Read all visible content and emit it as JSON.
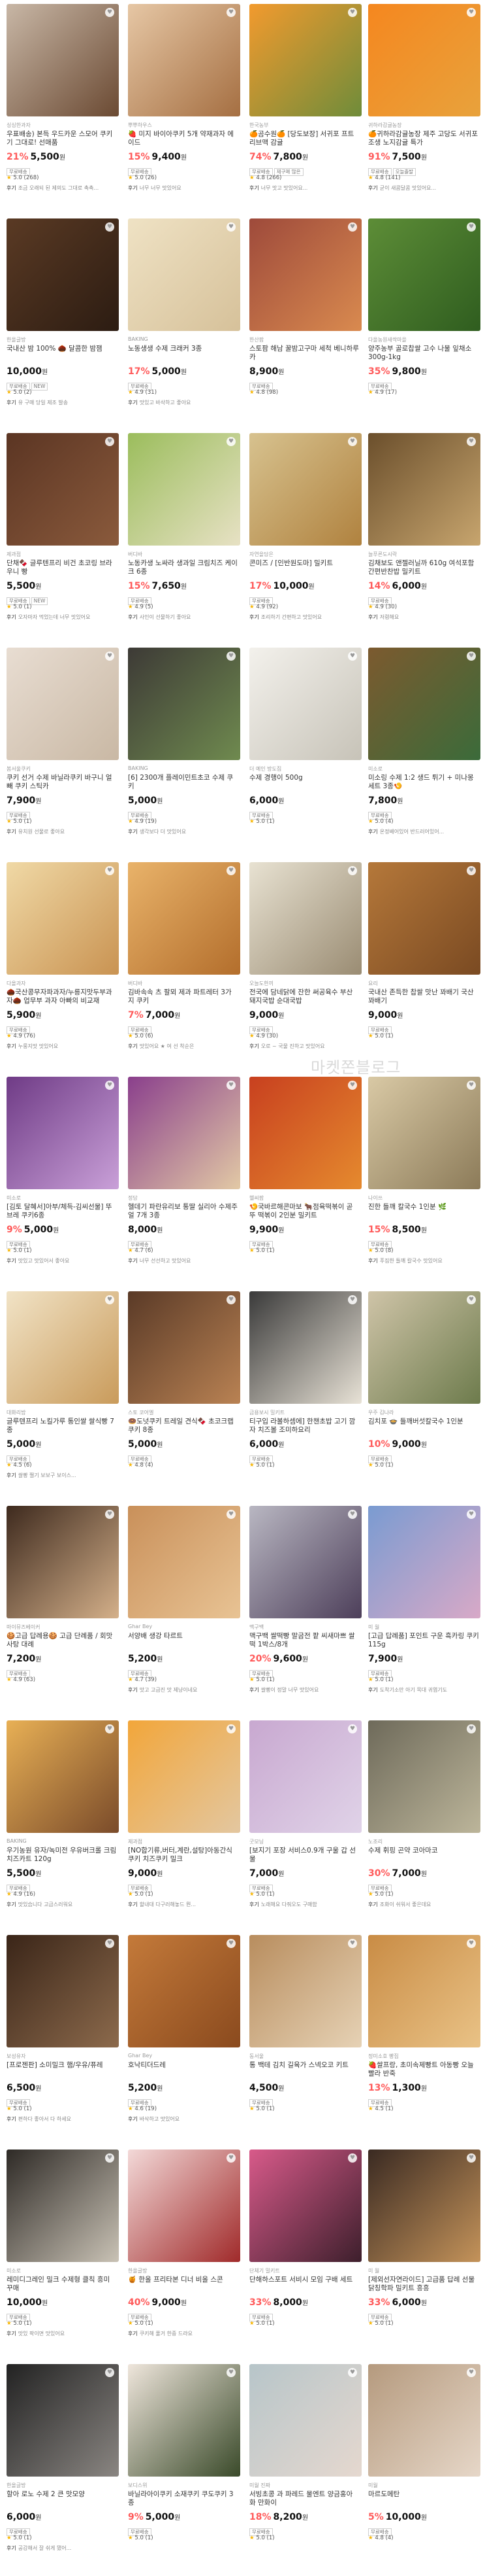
{
  "watermark": "마켓쫀블로그",
  "ui": {
    "tag_free": "무료배송",
    "tag_new": "NEW",
    "tag_min": "제구매 많은",
    "tag_today": "오늘출발",
    "review_label": "후기"
  },
  "products": [
    {
      "seller": "싱싱한과자",
      "name": "우표배송) 본득 우드카운 스모어 쿠키기 그대로! 선매품",
      "discount": "21%",
      "price": "5,500",
      "rating": "5.0",
      "reviews": "(268)",
      "review": "조금 오래되 된 제의도 그대로 촉촉...",
      "tags": [
        "무료배송"
      ],
      "colors": [
        "#c8b7a6",
        "#6b4a33"
      ]
    },
    {
      "seller": "뿌뿌하우스",
      "name": "🍓 미지 바이아쿠키 5개 약재과자 에이드",
      "discount": "15%",
      "price": "9,400",
      "rating": "5.0",
      "reviews": "(26)",
      "review": "너무 너무 맛있어요",
      "tags": [
        "무료배송"
      ],
      "colors": [
        "#e6c7a5",
        "#a56f42"
      ]
    },
    {
      "seller": "한국농부",
      "name": "🍊곰수원🍊 [당도보장] 서귀포 프트 리브맥 감귤",
      "discount": "74%",
      "price": "7,800",
      "rating": "4.8",
      "reviews": "(266)",
      "review": "너무 맛고 맛있어요...",
      "tags": [
        "무료배송",
        "제구매 많은"
      ],
      "colors": [
        "#f29a2e",
        "#6f8c3a"
      ]
    },
    {
      "seller": "귀하라감귤농장",
      "name": "🍊귀하라감귤농장 제주 고당도 서귀포조생 노지감귤 특가",
      "discount": "91%",
      "price": "7,500",
      "rating": "4.8",
      "reviews": "(141)",
      "review": "굳이 새콤달콤 맛있어요...",
      "tags": [
        "무료배송",
        "오늘출발"
      ],
      "colors": [
        "#f5871f",
        "#e8a23c"
      ]
    },
    {
      "seller": "한올글방",
      "name": "국내산 밤 100% 🌰 달콤한 밤잼",
      "discount": "",
      "price": "10,000",
      "rating": "5.0",
      "reviews": "(2)",
      "review": "유 구매 당일 제조 발송",
      "tags": [
        "무료배송",
        "NEW"
      ],
      "colors": [
        "#5a3a24",
        "#2c1c12"
      ]
    },
    {
      "seller": "BAKING",
      "name": "노동생생 수제 크래커 3종",
      "discount": "17%",
      "price": "5,000",
      "rating": "4.9",
      "reviews": "(31)",
      "review": "맛있고 바삭하고 좋아요",
      "tags": [
        "무료배송"
      ],
      "colors": [
        "#efe2c4",
        "#d6c19a"
      ]
    },
    {
      "seller": "한산팜",
      "name": "스토팜 해남 꿀밤고구마 세척 베니하루카",
      "discount": "",
      "price": "8,900",
      "rating": "4.8",
      "reviews": "(98)",
      "review": "",
      "tags": [
        "무료배송"
      ],
      "colors": [
        "#9e4a3b",
        "#d98a4f"
      ]
    },
    {
      "seller": "다올농원새싹마을",
      "name": "양주농부 골로찹쌀 고수 나물 잎채소 300g-1kg",
      "discount": "35%",
      "price": "9,800",
      "rating": "4.9",
      "reviews": "(17)",
      "review": "",
      "tags": [
        "무료배송"
      ],
      "colors": [
        "#5d8d37",
        "#2f5d1f"
      ]
    },
    {
      "seller": "제과점",
      "name": "단채🍫 글루텐프리 비건 초코링 브라우니 빵",
      "discount": "",
      "price": "5,500",
      "rating": "5.0",
      "reviews": "(1)",
      "review": "오자마자 먹었는데 너무 맛있어요",
      "tags": [
        "무료배송",
        "NEW"
      ],
      "colors": [
        "#5b3523",
        "#8a5a3c"
      ]
    },
    {
      "seller": "버디바",
      "name": "노동카생 노싸라 생과일 크림치즈 케이크 6종",
      "discount": "15%",
      "price": "7,650",
      "rating": "4.9",
      "reviews": "(5)",
      "review": "사인이 선물하기 좋아요",
      "tags": [
        "무료배송"
      ],
      "colors": [
        "#9bbd5c",
        "#e7e1c4"
      ]
    },
    {
      "seller": "자연을담은",
      "name": "콘미즈 / [인반원도마] 밀키트",
      "discount": "17%",
      "price": "10,000",
      "rating": "4.9",
      "reviews": "(92)",
      "review": "조리하기 간편하고 맛있어요",
      "tags": [
        "무료배송"
      ],
      "colors": [
        "#d7c28f",
        "#b0823f"
      ]
    },
    {
      "seller": "늘푸른도시락",
      "name": "김채보도 앤젤러닐까 610g 여석포함 간편반찬밥 밀키트",
      "discount": "14%",
      "price": "6,000",
      "rating": "4.9",
      "reviews": "(30)",
      "review": "저렴해요",
      "tags": [
        "무료배송"
      ],
      "colors": [
        "#6b4f2c",
        "#c7a56e"
      ]
    },
    {
      "seller": "봄서울쿠키",
      "name": "쿠키 선거 수제 바닐라쿠키 바구니 얼빼 쿠키 스틱카",
      "discount": "",
      "price": "7,900",
      "rating": "5.0",
      "reviews": "(1)",
      "review": "유치원 선물로 좋아요",
      "tags": [
        "무료배송"
      ],
      "colors": [
        "#e8ddd2",
        "#c9b8a4"
      ]
    },
    {
      "seller": "BAKING",
      "name": "[6] 2300개 플레이민트초코 수제 쿠키",
      "discount": "",
      "price": "5,000",
      "rating": "4.9",
      "reviews": "(19)",
      "review": "생각보다 더 맛있어요",
      "tags": [
        "무료배송"
      ],
      "colors": [
        "#3d3a36",
        "#6f8a4f"
      ]
    },
    {
      "seller": "더 예인 방도집",
      "name": "수제 경행이 500g",
      "discount": "",
      "price": "6,000",
      "rating": "5.0",
      "reviews": "(1)",
      "review": "",
      "tags": [
        "무료배송"
      ],
      "colors": [
        "#f3f1ec",
        "#c7c3b8"
      ]
    },
    {
      "seller": "미소로",
      "name": "미소링 수제 1:2 생드 튀기 + 미나몽세트 3종🍤",
      "discount": "",
      "price": "7,800",
      "rating": "5.0",
      "reviews": "(4)",
      "review": "온정배어있어 반드러어있어...",
      "tags": [
        "무료배송"
      ],
      "colors": [
        "#7c5a2f",
        "#3b6b3a"
      ]
    },
    {
      "seller": "다올과자",
      "name": "🌰국산콩무자파과자/누릉지맛두부과자🌰 업무부 과자 아빠의 비교재",
      "discount": "",
      "price": "5,900",
      "rating": "4.9",
      "reviews": "(76)",
      "review": "누룽지맛 맛있어요",
      "tags": [
        "무료배송"
      ],
      "colors": [
        "#f0d9a6",
        "#c99352"
      ]
    },
    {
      "seller": "버디바",
      "name": "김바속속 츠 팔뫼 제과 파트레터 3가 지 쿠키",
      "discount": "7%",
      "price": "7,000",
      "rating": "5.0",
      "reviews": "(6)",
      "review": "맛있어요 ★ 여 선 착순은",
      "tags": [
        "무료배송"
      ],
      "colors": [
        "#e9b36a",
        "#b36e2c"
      ]
    },
    {
      "seller": "오늘도한끼",
      "name": "전국에 담네닭에 잔한 써공육수 부산 돼지국밥 순대국밥",
      "discount": "",
      "price": "9,000",
      "rating": "4.9",
      "reviews": "(30)",
      "review": "오로 ~ 국물 진하고 맛있어요",
      "tags": [
        "무료배송"
      ],
      "colors": [
        "#e8e2d2",
        "#9a8c73"
      ]
    },
    {
      "seller": "요리",
      "name": "국내산 존득한 찹쌀 맛난 꽈배기 국산 꽈배기",
      "discount": "",
      "price": "9,000",
      "rating": "5.0",
      "reviews": "(1)",
      "review": "",
      "tags": [
        "무료배송"
      ],
      "colors": [
        "#b5783a",
        "#7a4a22"
      ]
    },
    {
      "seller": "미소로",
      "name": "[김토 달혜서]아부/체득-김씨선물] 뚜 브레 쿠키6종",
      "discount": "9%",
      "price": "5,000",
      "rating": "5.0",
      "reviews": "(1)",
      "review": "맛있고 맛있어서 좋아요",
      "tags": [
        "무료배송"
      ],
      "colors": [
        "#6f3b86",
        "#c9a0d8"
      ]
    },
    {
      "seller": "정담",
      "name": "헬데기 파란유리보 통딸 실리아 수제주얼 7개 3종",
      "discount": "",
      "price": "8,000",
      "rating": "4.7",
      "reviews": "(6)",
      "review": "너무 선선하고 맛있어요",
      "tags": [
        "무료배송"
      ],
      "colors": [
        "#8a3f8c",
        "#e2c9a5"
      ]
    },
    {
      "seller": "헬씨팜",
      "name": "🍤국바르해콘마보 🐂점육떡볶이 곧 뚜 떡볶이 2인분 밀키트",
      "discount": "",
      "price": "9,900",
      "rating": "5.0",
      "reviews": "(1)",
      "review": "",
      "tags": [
        "무료배송"
      ],
      "colors": [
        "#c8401f",
        "#e58a2e"
      ]
    },
    {
      "seller": "나이쓰",
      "name": "진한 들깨 칼국수 1인분 🌿",
      "discount": "15%",
      "price": "8,500",
      "rating": "5.0",
      "reviews": "(8)",
      "review": "푸짐한 들깨 칼국수 맛있어요",
      "tags": [
        "무료배송"
      ],
      "colors": [
        "#d9c9a5",
        "#8c7b59"
      ]
    },
    {
      "seller": "대화리밤",
      "name": "글루텐프리 노킬가루 통인쌀 쌀식빵 7종",
      "discount": "",
      "price": "5,000",
      "rating": "4.5",
      "reviews": "(6)",
      "review": "쌀빵 쩔기 보보구 보이스...",
      "tags": [
        "무료배송"
      ],
      "colors": [
        "#f1e3c6",
        "#c99b5b"
      ]
    },
    {
      "seller": "스토 코어엘",
      "name": "🍩도넛쿠키 트레일 견식🍫 초코크랩쿠키 8종",
      "discount": "",
      "price": "5,000",
      "rating": "4.8",
      "reviews": "(4)",
      "review": "",
      "tags": [
        "무료배송"
      ],
      "colors": [
        "#5a3a27",
        "#b98253"
      ]
    },
    {
      "seller": "금용보시 밀키트",
      "name": "티구입 라볼하셈에] 한챈초밥 고기 깜자 치즈볼 조미하요리",
      "discount": "",
      "price": "6,000",
      "rating": "5.0",
      "reviews": "(1)",
      "review": "",
      "tags": [
        "무료배송"
      ],
      "colors": [
        "#3a3a3a",
        "#e8e2d6"
      ]
    },
    {
      "seller": "우주 김나라",
      "name": "김치포 🍲 들깨버섯칼국수 1인분",
      "discount": "10%",
      "price": "9,000",
      "rating": "5.0",
      "reviews": "(1)",
      "review": "",
      "tags": [
        "무료배송"
      ],
      "colors": [
        "#cfc4a8",
        "#6d7b4c"
      ]
    },
    {
      "seller": "마이뮤즈베이커",
      "name": "🍪고급 답례용🍪 고급 단례품 / 회맛사탕 대례",
      "discount": "",
      "price": "7,200",
      "rating": "4.9",
      "reviews": "(63)",
      "review": "",
      "tags": [
        "무료배송"
      ],
      "colors": [
        "#3e2a1e",
        "#d4b08a"
      ]
    },
    {
      "seller": "Ghar Bey",
      "name": "서양배 생강 타르트",
      "discount": "",
      "price": "5,200",
      "rating": "4.7",
      "reviews": "(39)",
      "review": "맛고 고급진 맛 제냥이네요",
      "tags": [
        "무료배송"
      ],
      "colors": [
        "#c9905a",
        "#e8c394"
      ]
    },
    {
      "seller": "맥구백",
      "name": "맥구백 쌀떡빵 말굽전 팥 씨새마쁘 쌀떡 1박스/8개",
      "discount": "20%",
      "price": "9,600",
      "rating": "5.0",
      "reviews": "(1)",
      "review": "쌀빵이 정말 너무 맛있어요",
      "tags": [
        "무료배송"
      ],
      "colors": [
        "#b9b7c2",
        "#4d3f5a"
      ]
    },
    {
      "seller": "미 월",
      "name": "[고급 답례품] 포인트 구운 흑카링 쿠키 115g",
      "discount": "",
      "price": "7,900",
      "rating": "5.0",
      "reviews": "(1)",
      "review": "도착기소만 아기 목대 귀엽기도",
      "tags": [
        "무료배송"
      ],
      "colors": [
        "#7a9bd1",
        "#d8a9c7"
      ]
    },
    {
      "seller": "BAKING",
      "name": "우기농원 유자/녹미전 우유버크롤 크림치즈카트 120g",
      "discount": "",
      "price": "5,500",
      "rating": "4.9",
      "reviews": "(16)",
      "review": "맛있습니다 고급스러워요",
      "tags": [
        "무료배송"
      ],
      "colors": [
        "#e8b055",
        "#7a4b2a"
      ]
    },
    {
      "seller": "제과점",
      "name": "[NO합기류,버터,계란,설탕]아동간식 쿠키 치즈쿠키 밀크",
      "discount": "",
      "price": "9,000",
      "rating": "5.0",
      "reviews": "(1)",
      "review": "할내대 다구러해놓드 뭔...",
      "tags": [
        "무료배송"
      ],
      "colors": [
        "#f2a63a",
        "#e3c7a0"
      ]
    },
    {
      "seller": "굿모닝",
      "name": "[보지기 포장 서비스0.9개 구울 갑 선물",
      "discount": "",
      "price": "7,000",
      "rating": "5.0",
      "reviews": "(1)",
      "review": "노래해요 다줘오도 구매함",
      "tags": [
        "무료배송"
      ],
      "colors": [
        "#c8a8d0",
        "#e0d3e8"
      ]
    },
    {
      "seller": "노조리",
      "name": "수제 휘핑 곤약 코아마코",
      "discount": "30%",
      "price": "7,000",
      "rating": "5.0",
      "reviews": "(1)",
      "review": "조화이 쉬워서 좋은데요",
      "tags": [
        "무료배송"
      ],
      "colors": [
        "#6e6a5a",
        "#bcb59a"
      ]
    },
    {
      "seller": "보성유자",
      "name": "[프로젠판] 소미밀크 햄/우유/퓨레",
      "discount": "",
      "price": "6,500",
      "rating": "5.0",
      "reviews": "(1)",
      "review": "편하다 좋아서 다 하세요",
      "tags": [
        "무료배송"
      ],
      "colors": [
        "#3a2518",
        "#8c6a4c"
      ]
    },
    {
      "seller": "Ghar Bey",
      "name": "호낙티더드레",
      "discount": "",
      "price": "5,200",
      "rating": "4.6",
      "reviews": "(19)",
      "review": "바삭하고 맛있어요",
      "tags": [
        "무료배송"
      ],
      "colors": [
        "#c47a3a",
        "#8a4a1e"
      ]
    },
    {
      "seller": "동서울",
      "name": "통 백테 김치 길육가 스넥오코 키트",
      "discount": "",
      "price": "4,500",
      "rating": "5.0",
      "reviews": "(1)",
      "review": "",
      "tags": [
        "무료배송"
      ],
      "colors": [
        "#b88d5e",
        "#e6d2b5"
      ]
    },
    {
      "seller": "정미소호 빵집",
      "name": "🍓쌀프랑, 초미속제빵트 아동빵 오늘 빨라 반죽",
      "discount": "13%",
      "price": "1,300",
      "rating": "4.5",
      "reviews": "(1)",
      "review": "",
      "tags": [
        "무료배송"
      ],
      "colors": [
        "#c98c45",
        "#e9c286"
      ]
    },
    {
      "seller": "미소로",
      "name": "레미디그레인 밀크 수제형 클칙 흥미 꾸매",
      "discount": "",
      "price": "10,000",
      "rating": "5.0",
      "reviews": "(1)",
      "review": "맛있 팍이면 맛있어요",
      "tags": [
        "무료배송"
      ],
      "colors": [
        "#2e2a26",
        "#c9c2b5"
      ]
    },
    {
      "seller": "한올글방",
      "name": "🍯 한올 프리타본 디너 비올 스콘",
      "discount": "40%",
      "price": "9,000",
      "rating": "5.0",
      "reviews": "(1)",
      "review": "쿠키해 풀거 한중 드랴요",
      "tags": [
        "무료배송"
      ],
      "colors": [
        "#f3d9d8",
        "#a02a2a"
      ]
    },
    {
      "seller": "단체기 밀키트",
      "name": "단해하스포트 서비시 모임 구배 세트",
      "discount": "33%",
      "price": "8,000",
      "rating": "5.0",
      "reviews": "(1)",
      "review": "",
      "tags": [
        "무료배송"
      ],
      "colors": [
        "#d85a8a",
        "#3d1f2c"
      ]
    },
    {
      "seller": "미 월",
      "name": "[제외선자연라이드] 고급품 답례 선물 닭칭학파 밀키트 흥흥",
      "discount": "33%",
      "price": "6,000",
      "rating": "5.0",
      "reviews": "(1)",
      "review": "",
      "tags": [
        "무료배송"
      ],
      "colors": [
        "#3a2a22",
        "#c4935a"
      ]
    },
    {
      "seller": "한올글방",
      "name": "할아 로노 수제 2 큰 맛모양",
      "discount": "",
      "price": "6,000",
      "rating": "5.0",
      "reviews": "(1)",
      "review": "공감해서 잘 쉬게 됐어...",
      "tags": [
        "무료배송"
      ],
      "colors": [
        "#222222",
        "#8a8682"
      ]
    },
    {
      "seller": "보디스위",
      "name": "바닐라아이쿠키 소재쿠키 쿠도쿠키 3종",
      "discount": "9%",
      "price": "5,000",
      "rating": "5.0",
      "reviews": "(1)",
      "review": "",
      "tags": [
        "무료배송"
      ],
      "colors": [
        "#efe6dc",
        "#3a4a2a"
      ]
    },
    {
      "seller": "미월 진짜",
      "name": "서빙초콩 과 파레드 물엔트 양금홍아 화 만화이",
      "discount": "18%",
      "price": "8,200",
      "rating": "5.0",
      "reviews": "(1)",
      "review": "",
      "tags": [
        "무료배송"
      ],
      "colors": [
        "#b7c5c9",
        "#e5d8cf"
      ]
    },
    {
      "seller": "미월",
      "name": "마르도메탄",
      "discount": "5%",
      "price": "10,000",
      "rating": "4.8",
      "reviews": "(4)",
      "review": "",
      "tags": [
        "무료배송"
      ],
      "colors": [
        "#b59a7e",
        "#e6d7c8"
      ]
    }
  ]
}
